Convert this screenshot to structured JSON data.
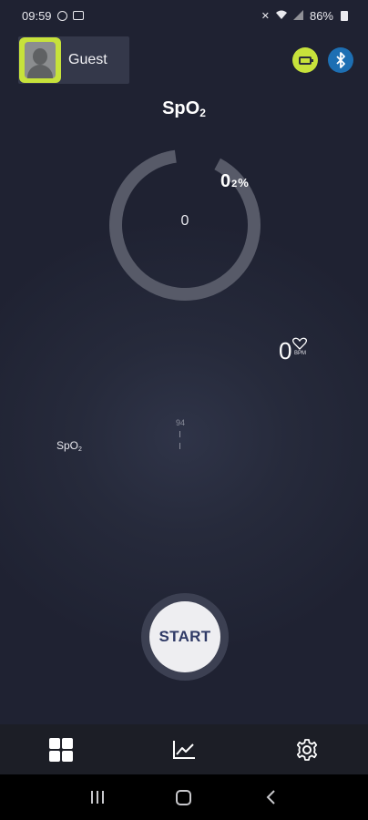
{
  "status_bar": {
    "time": "09:59",
    "battery": "86%"
  },
  "header": {
    "user_name": "Guest"
  },
  "title": {
    "main": "Sp",
    "o": "O",
    "sub": "2"
  },
  "gauge": {
    "center_value": "0",
    "spo2_value": "0",
    "spo2_sub": "2",
    "spo2_unit": "%",
    "fill_fraction": 0
  },
  "pulse": {
    "value": "0",
    "unit": "BPM"
  },
  "graph": {
    "label_main": "SpO",
    "label_sub": "2",
    "tick_label": "94"
  },
  "start_button": {
    "label": "START"
  },
  "colors": {
    "accent": "#c7e23b",
    "bluetooth": "#1d6fb3",
    "start_text": "#2f3a66",
    "gauge_ring": "#5a5d6a"
  },
  "icons": {
    "battery": "battery-icon",
    "bluetooth": "bluetooth-icon",
    "dashboard": "dashboard-grid-icon",
    "history": "chart-line-icon",
    "settings": "gear-icon"
  }
}
